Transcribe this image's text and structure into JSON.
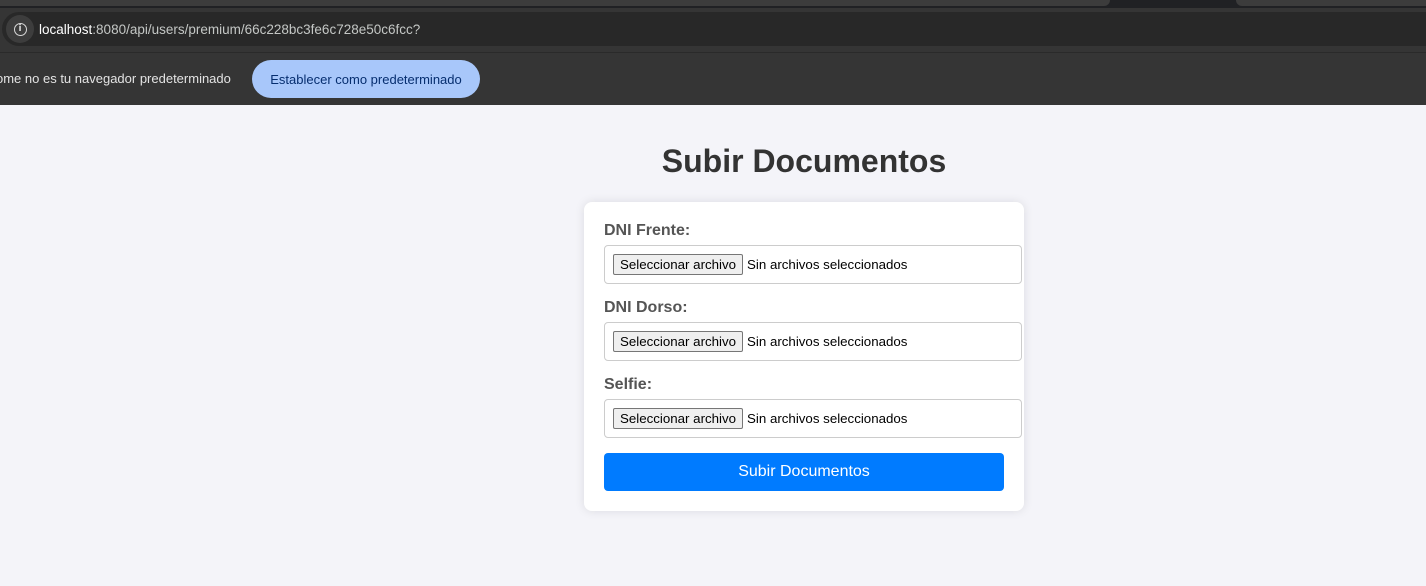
{
  "browser": {
    "url_host": "localhost",
    "url_path": ":8080/api/users/premium/66c228bc3fe6c728e50c6fcc?",
    "infobar_message": "ome no es tu navegador predeterminado",
    "set_default_label": "Establecer como predeterminado"
  },
  "page": {
    "title": "Subir Documentos",
    "fields": [
      {
        "label": "DNI Frente:",
        "button_label": "Seleccionar archivo",
        "status": "Sin archivos seleccionados"
      },
      {
        "label": "DNI Dorso:",
        "button_label": "Seleccionar archivo",
        "status": "Sin archivos seleccionados"
      },
      {
        "label": "Selfie:",
        "button_label": "Seleccionar archivo",
        "status": "Sin archivos seleccionados"
      }
    ],
    "submit_label": "Subir Documentos"
  },
  "colors": {
    "page_background": "#f4f4f9",
    "submit_button": "#007bff",
    "infobar_button": "#a8c7fa",
    "browser_chrome": "#353535"
  },
  "icons": {
    "site_info": "info-circle-icon"
  }
}
